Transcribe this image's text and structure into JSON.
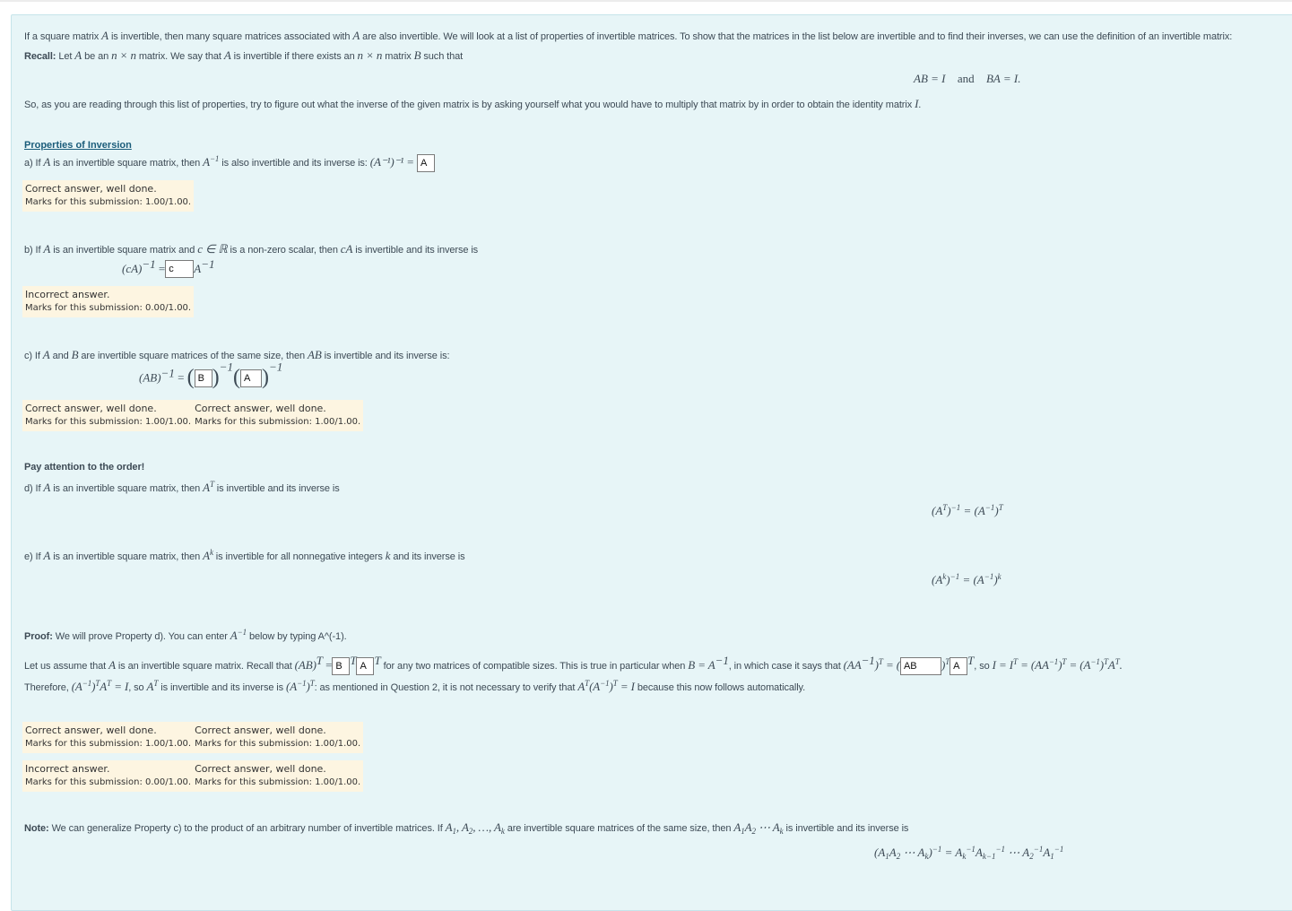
{
  "intro": {
    "line1_a": "If a square matrix ",
    "var_A": "A",
    "line1_b": " is invertible, then many square matrices associated with ",
    "line1_c": " are also invertible. We will look at a list of properties of invertible matrices. To show that the matrices in the list below are invertible and to find their inverses, we can use the definition of an invertible matrix:",
    "recall_label": "Recall:",
    "recall_a": " Let ",
    "recall_b": " be an ",
    "nxn": "n × n",
    "recall_c": " matrix. We say that ",
    "recall_d": " is invertible if there exists an ",
    "recall_e": " matrix ",
    "var_B": "B",
    "recall_f": " such that",
    "eq_left": "AB = I",
    "eq_and": "and",
    "eq_right": "BA = I.",
    "so_text": "So, as you are reading through this list of properties, try to figure out what the inverse of the given matrix is by asking yourself what you would have to multiply that matrix by in order to obtain the identity matrix ",
    "var_I": "I",
    "period": "."
  },
  "properties_heading": "Properties of Inversion",
  "part_a": {
    "text_a": "a) If ",
    "text_b": " is an invertible square matrix, then ",
    "text_c": " is also invertible and its inverse is: ",
    "lhs": "(A⁻¹)⁻¹ =",
    "answer": "A",
    "feedback": {
      "status": "Correct answer, well done.",
      "marks": "Marks for this submission: 1.00/1.00."
    }
  },
  "part_b": {
    "text_a": "b) If ",
    "text_b": " is an invertible square matrix and ",
    "c_in_R": "c ∈ ℝ",
    "text_c": " is a non-zero scalar, then ",
    "cA": "cA",
    "text_d": " is invertible and its inverse is",
    "lhs": "(cA)",
    "sup": "−1",
    "eq": " =",
    "answer": "c",
    "rhs": "A",
    "feedback": {
      "status": "Incorrect answer.",
      "marks": "Marks for this submission: 0.00/1.00."
    }
  },
  "part_c": {
    "text_a": "c) If ",
    "text_b": " and ",
    "text_c": " are invertible square matrices of the same size, then ",
    "AB": "AB",
    "text_d": " is invertible and its inverse is:",
    "lhs": "(AB)",
    "sup": "−1",
    "eq": " = ",
    "answer1": "B",
    "answer2": "A",
    "feedback": [
      {
        "status": "Correct answer, well done.",
        "marks": "Marks for this submission: 1.00/1.00."
      },
      {
        "status": "Correct answer, well done.",
        "marks": "Marks for this submission: 1.00/1.00."
      }
    ]
  },
  "attention": "Pay attention to the order!",
  "part_d": {
    "text_a": "d) If ",
    "text_b": " is an invertible square matrix, then ",
    "text_c": " is invertible and its inverse is",
    "formula_lhs": "(A",
    "formula_mid": ")",
    "formula_eq": " = (A",
    "formula_end": ")"
  },
  "part_e": {
    "text_a": "e)  If ",
    "text_b": " is an invertible square matrix, then ",
    "text_c": " is invertible for all nonnegative integers ",
    "var_k": "k",
    "text_d": " and its inverse is"
  },
  "proof": {
    "label": "Proof:",
    "text_a": " We will prove Property d). You can enter ",
    "text_b": " below by typing A^(-1).",
    "line1_a": "Let us assume that ",
    "line1_b": " is an invertible square matrix. Recall that ",
    "ab_t": "(AB)",
    "eq": " =",
    "answer1": "B",
    "answer2": "A",
    "line1_c": " for any two matrices of compatible sizes. This is true in particular when ",
    "b_eq": "B = A",
    "line1_d": ", in which case it says that ",
    "aat": "(AA",
    "answer3": "AB",
    "answer4": "A",
    "line1_e": ", so ",
    "tail": "I = I",
    "line2_a": "Therefore, ",
    "line2_b": ", so ",
    "line2_c": " is invertible and its inverse is ",
    "line2_d": ": as mentioned in Question 2, it is not necessary to verify that ",
    "line2_e": " because this now follows automatically.",
    "feedback_rows": [
      [
        {
          "status": "Correct answer, well done.",
          "marks": "Marks for this submission: 1.00/1.00."
        },
        {
          "status": "Correct answer, well done.",
          "marks": "Marks for this submission: 1.00/1.00."
        }
      ],
      [
        {
          "status": "Incorrect answer.",
          "marks": "Marks for this submission: 0.00/1.00."
        },
        {
          "status": "Correct answer, well done.",
          "marks": "Marks for this submission: 1.00/1.00."
        }
      ]
    ]
  },
  "note": {
    "label": "Note:",
    "text_a": " We can generalize Property c) to the product of an arbitrary number of invertible matrices.  If ",
    "text_b": " are invertible square matrices of the same size, then ",
    "text_c": " is invertible and its inverse is"
  }
}
